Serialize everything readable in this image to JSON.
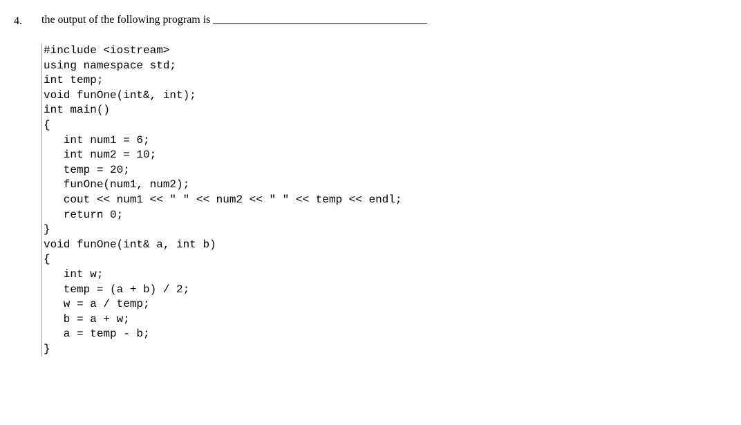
{
  "question": {
    "number": "4.",
    "prompt": "the output of the following program is "
  },
  "code": {
    "lines": [
      "#include <iostream>",
      "using namespace std;",
      "int temp;",
      "void funOne(int&, int);",
      "int main()",
      "{",
      "   int num1 = 6;",
      "   int num2 = 10;",
      "   temp = 20;",
      "   funOne(num1, num2);",
      "   cout << num1 << \" \" << num2 << \" \" << temp << endl;",
      "   return 0;",
      "}",
      "void funOne(int& a, int b)",
      "{",
      "   int w;",
      "   temp = (a + b) / 2;",
      "   w = a / temp;",
      "   b = a + w;",
      "   a = temp - b;",
      "}"
    ]
  }
}
